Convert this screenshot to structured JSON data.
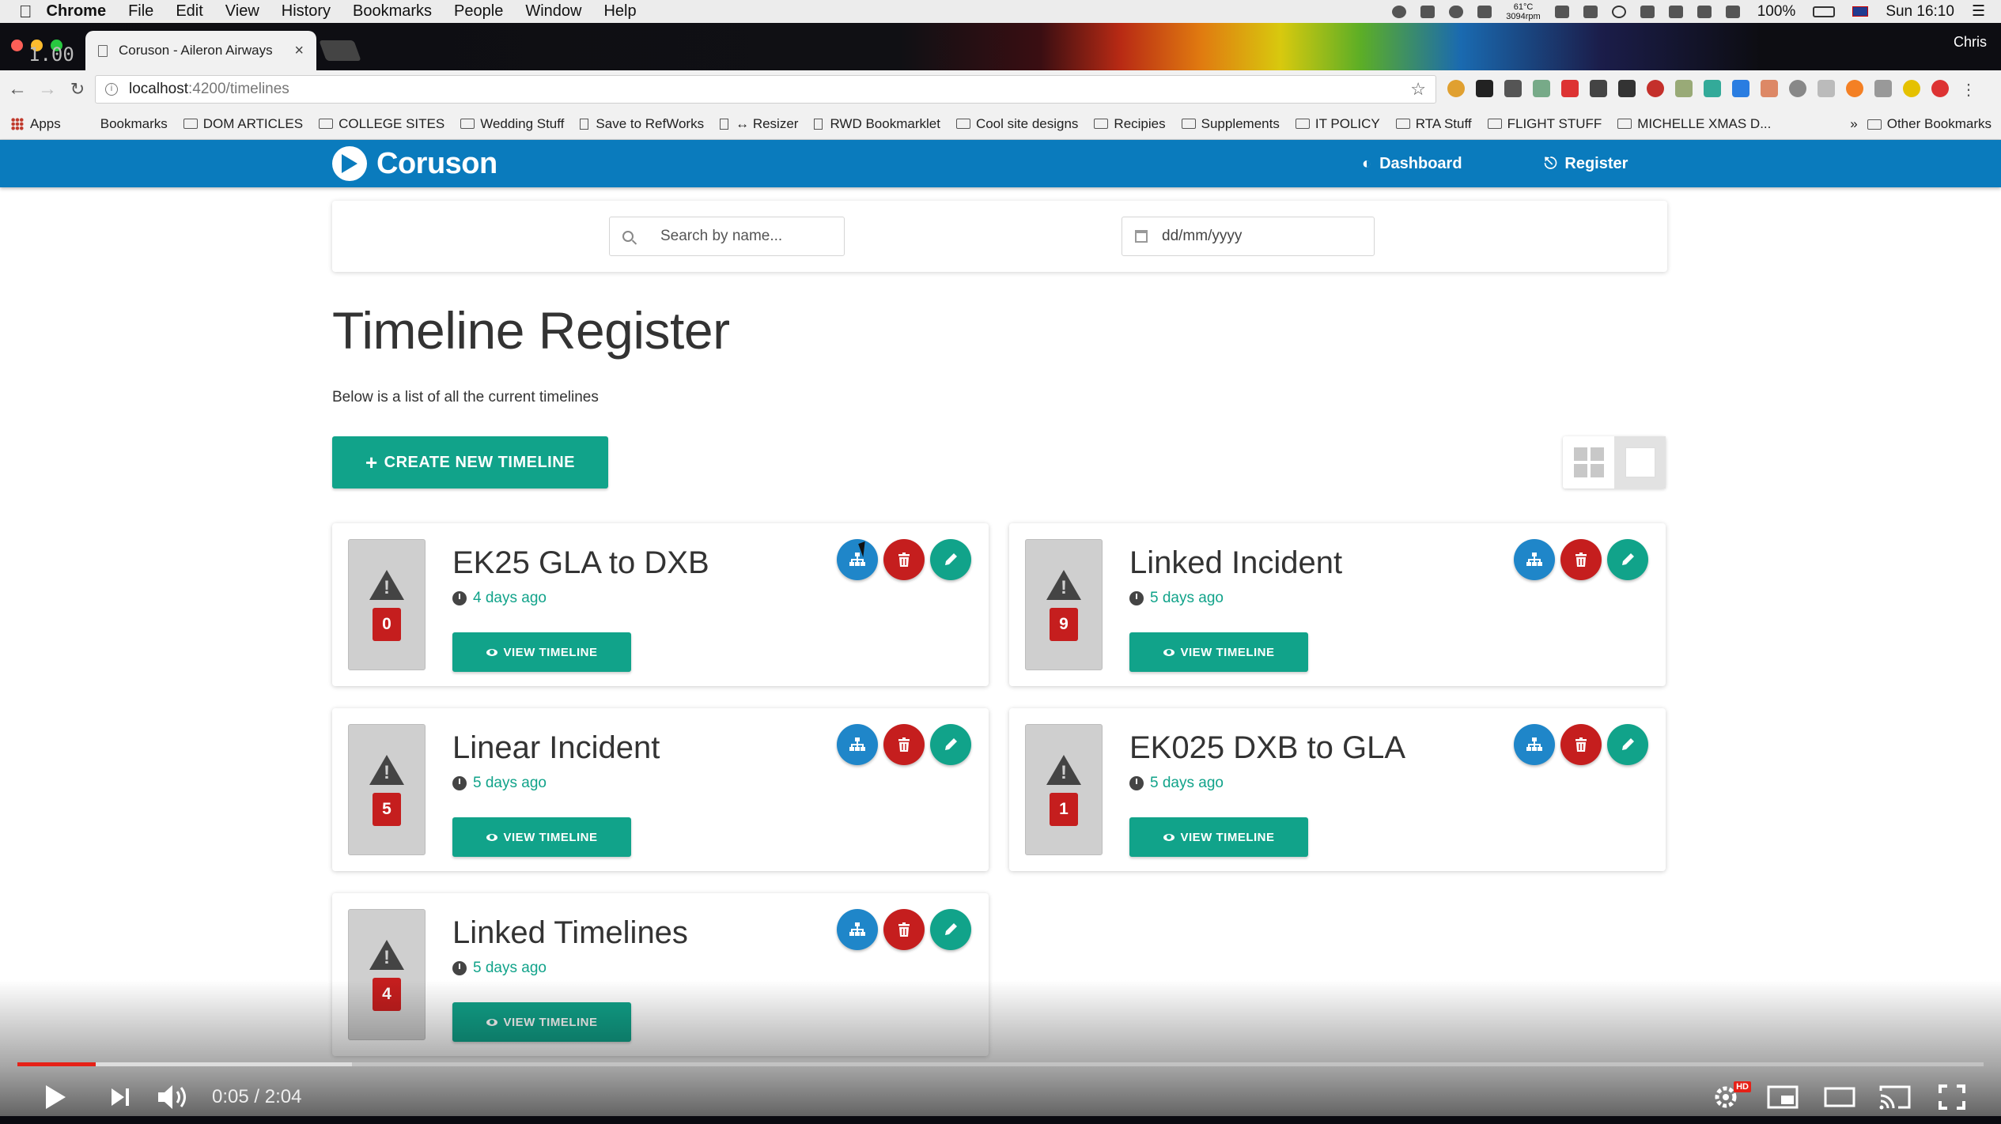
{
  "menubar": {
    "app": "Chrome",
    "items": [
      "File",
      "Edit",
      "View",
      "History",
      "Bookmarks",
      "People",
      "Window",
      "Help"
    ],
    "temp_top": "61°C",
    "temp_bottom": "3094rpm",
    "battery": "100%",
    "clock": "Sun 16:10"
  },
  "browser": {
    "tab_title": "Coruson - Aileron Airways",
    "profile": "Chris",
    "url_host": "localhost",
    "url_path": ":4200/timelines",
    "bookmarks": [
      "Apps",
      "Bookmarks",
      "DOM ARTICLES",
      "COLLEGE SITES",
      "Wedding Stuff",
      "Save to RefWorks",
      "↔ Resizer",
      "RWD Bookmarklet",
      "Cool site designs",
      "Recipies",
      "Supplements",
      "IT POLICY",
      "RTA Stuff",
      "FLIGHT STUFF",
      "MICHELLE XMAS D..."
    ],
    "other_bookmarks": "Other Bookmarks",
    "overlay_zoom": "1.00"
  },
  "app": {
    "brand": "Coruson",
    "nav": {
      "dashboard": "Dashboard",
      "register": "Register"
    },
    "search_placeholder": "Search by name...",
    "date_placeholder": "dd/mm/yyyy",
    "title": "Timeline Register",
    "subtitle": "Below is a list of all the current timelines",
    "create_button": "CREATE NEW TIMELINE",
    "view_button": "VIEW TIMELINE",
    "accent": "#11a38a",
    "nav_color": "#0a7bbd",
    "danger": "#c51e1e",
    "timelines": [
      {
        "title": "EK25 GLA to DXB",
        "age": "4 days ago",
        "count": "0"
      },
      {
        "title": "Linked Incident",
        "age": "5 days ago",
        "count": "9"
      },
      {
        "title": "Linear Incident",
        "age": "5 days ago",
        "count": "5"
      },
      {
        "title": "EK025 DXB to GLA",
        "age": "5 days ago",
        "count": "1"
      },
      {
        "title": "Linked Timelines",
        "age": "5 days ago",
        "count": "4"
      }
    ]
  },
  "video": {
    "time": "0:05 / 2:04",
    "progress": 0.04,
    "buffered": 0.17,
    "quality_badge": "HD"
  }
}
